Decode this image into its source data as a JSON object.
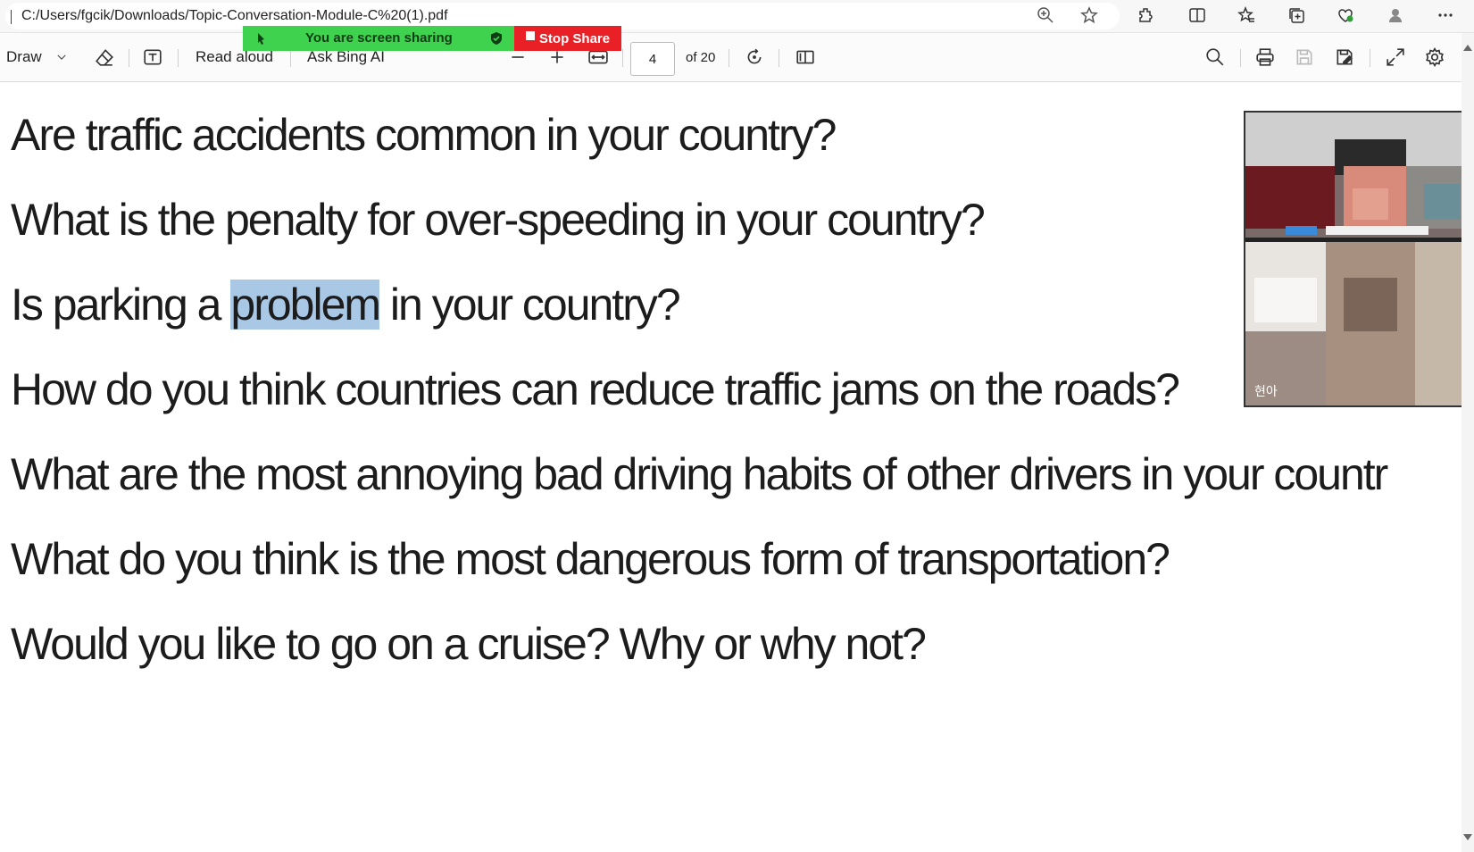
{
  "address_bar": {
    "path": "C:/Users/fgcik/Downloads/Topic-Conversation-Module-C%20(1).pdf"
  },
  "sharing_banner": {
    "text": "You are screen sharing",
    "stop_label": "Stop Share"
  },
  "toolbar": {
    "draw_label": "Draw",
    "read_aloud_label": "Read aloud",
    "ask_ai_label": "Ask Bing AI",
    "page_current": "4",
    "page_total": "of 20"
  },
  "document": {
    "questions": [
      "Are traffic accidents common in your country?",
      "What is the penalty for over-speeding in your country?",
      "Is parking a",
      "problem",
      " in your country?",
      "How do you think countries can reduce traffic jams on the roads?",
      "What are the most annoying bad driving habits of other drivers in your countr",
      "What do you think is the most dangerous form of transportation?",
      "Would you like to go on a cruise? Why or why not?"
    ]
  },
  "video_panel": {
    "participant_label": "현아"
  },
  "colors": {
    "share_green": "#3ed24f",
    "stop_red": "#ea2027",
    "highlight": "#a9c8e6"
  }
}
